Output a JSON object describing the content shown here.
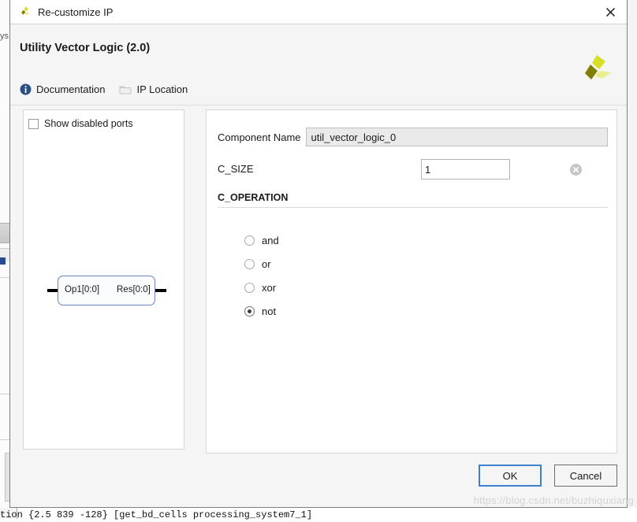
{
  "window": {
    "title": "Re-customize IP",
    "title_icon": "xilinx-logo-icon",
    "close_icon": "close-icon"
  },
  "header": {
    "ip_title": "Utility Vector Logic (2.0)",
    "logo_icon": "xilinx-logo",
    "links": [
      {
        "label": "Documentation",
        "icon": "info-icon"
      },
      {
        "label": "IP Location",
        "icon": "folder-icon"
      }
    ]
  },
  "symbol_panel": {
    "show_disabled_ports_label": "Show disabled ports",
    "show_disabled_ports_checked": false,
    "block": {
      "input_port": "Op1[0:0]",
      "output_port": "Res[0:0]"
    }
  },
  "config_panel": {
    "component_name_label": "Component Name",
    "component_name_value": "util_vector_logic_0",
    "c_size_label": "C_SIZE",
    "c_size_value": "1",
    "c_size_clear_icon": "clear-circle-icon",
    "c_operation_label": "C_OPERATION",
    "c_operation_selected": "not",
    "c_operation_options": [
      {
        "label": "and"
      },
      {
        "label": "or"
      },
      {
        "label": "xor"
      },
      {
        "label": "not"
      }
    ]
  },
  "footer": {
    "ok_label": "OK",
    "cancel_label": "Cancel"
  },
  "background": {
    "left_edge_text": "ys",
    "console_text": "tion {2.5 839 -128} [get_bd_cells processing_system7_1]"
  },
  "watermark": {
    "text": "https://blog.csdn.net/buzhiquxiang"
  },
  "colors": {
    "accent_blue": "#3f7fd0",
    "block_border": "#6b84b5",
    "logo_olive": "#808000",
    "logo_yellow": "#d7df23",
    "info_blue": "#2c4f86"
  }
}
